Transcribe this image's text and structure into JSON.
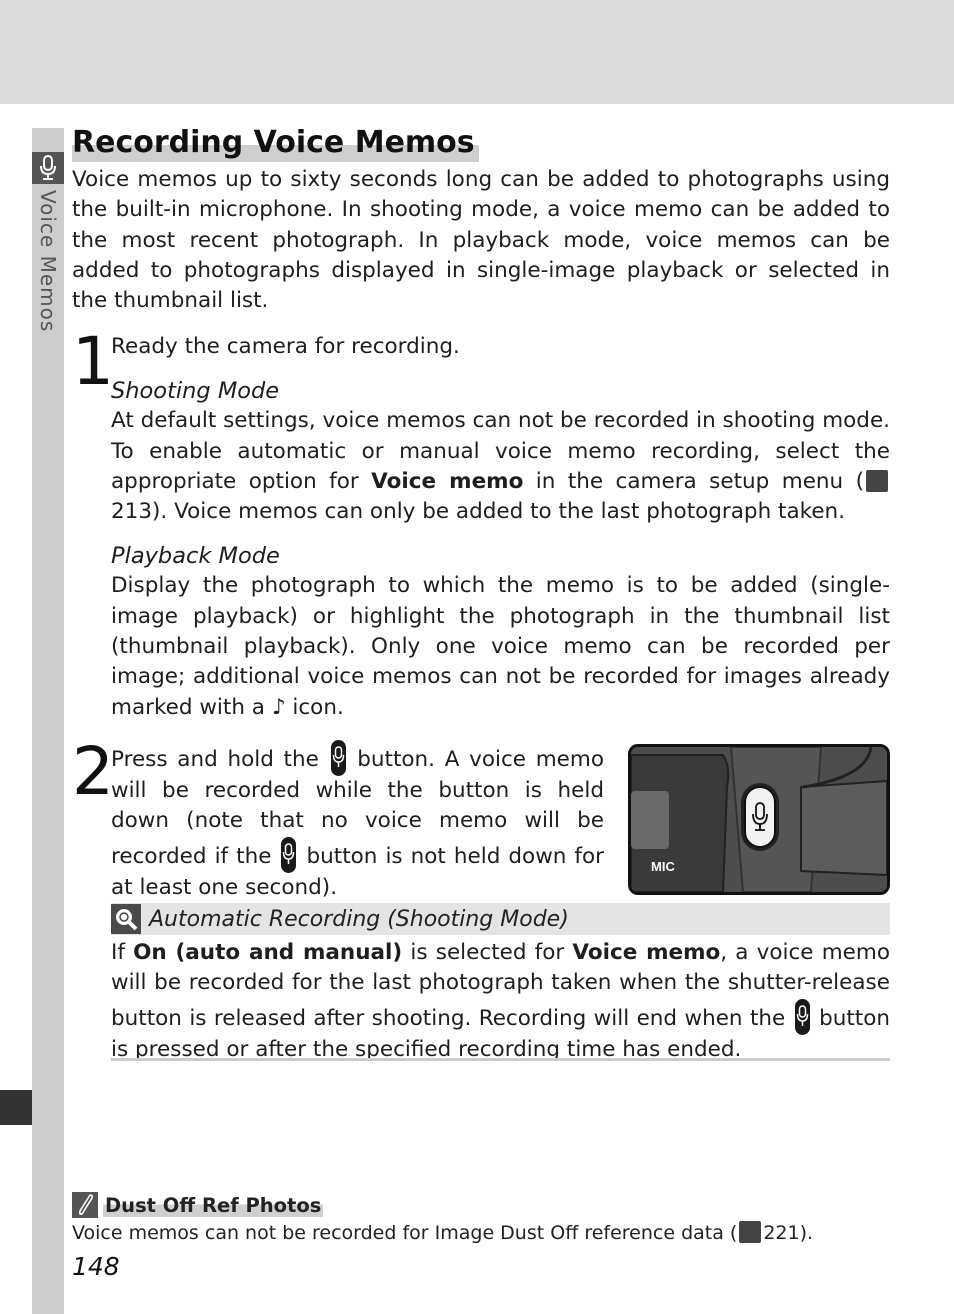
{
  "sidebar": {
    "section_label": "Voice Memos",
    "section_icon": "microphone-icon"
  },
  "title": "Recording Voice Memos",
  "intro": "Voice memos up to sixty seconds long can be added to photographs using the built-in microphone.  In shooting mode, a voice memo can be added to the most recent photograph.  In playback mode, voice memos can be added to photographs displayed in single-image playback or selected in the thumbnail list.",
  "step1": {
    "number": "1",
    "text": "Ready the camera for recording.",
    "shooting": {
      "heading": "Shooting Mode",
      "text_a": "At default settings, voice memos can not be recorded in shooting mode.  To enable automatic or manual voice memo recording, select the appropriate option for ",
      "bold": "Voice memo",
      "text_b": " in the camera setup menu (",
      "ref_page": "213",
      "text_c": ").  Voice memos can only be added to the last photograph taken."
    },
    "playback": {
      "heading": "Playback Mode",
      "text_a": "Display the photograph to which the memo is to be added (single-image playback) or highlight the photograph in the thumbnail list (thumbnail playback).  Only one voice memo can be recorded per image; additional voice memos can not be recorded for images already marked with a ",
      "note_glyph": "♪",
      "text_b": " icon."
    }
  },
  "step2": {
    "number": "2",
    "text_a": "Press and hold the ",
    "text_b": " button.  A voice memo will be recorded while the button is held down (note that no voice memo will be recorded if the ",
    "text_c": " button is not held down for at least one second).",
    "image_label": "MIC"
  },
  "tip": {
    "title": "Automatic Recording (Shooting Mode)",
    "text_a": "If ",
    "bold_a": "On (auto and manual)",
    "text_b": " is selected for ",
    "bold_b": "Voice memo",
    "text_c": ", a voice memo will be recorded for the last photograph taken when the shutter-release button is released after shooting.  Recording will end when the ",
    "text_d": " button is pressed or after the specified recording time has ended."
  },
  "note": {
    "title": "Dust Off Ref Photos",
    "text_a": "Voice memos can not be recorded for Image Dust Off reference data (",
    "ref_page": "221",
    "text_b": ")."
  },
  "page_number": "148"
}
